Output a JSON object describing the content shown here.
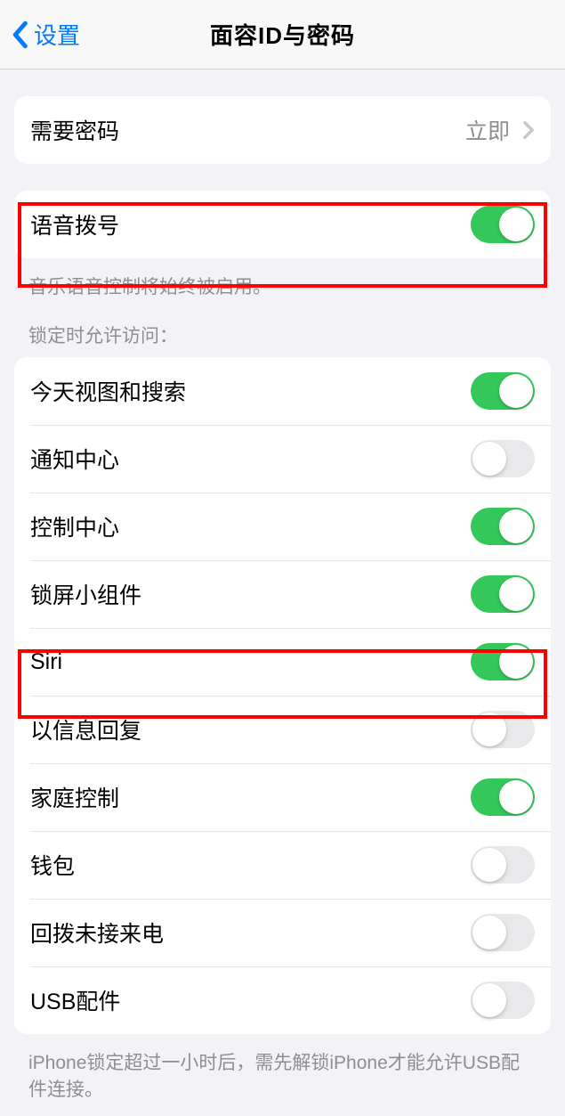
{
  "nav": {
    "back_label": "设置",
    "title": "面容ID与密码"
  },
  "group1": {
    "require_passcode": {
      "label": "需要密码",
      "value": "立即"
    }
  },
  "group2": {
    "voice_dial": {
      "label": "语音拨号",
      "on": true
    },
    "footer": "音乐语音控制将始终被启用。"
  },
  "group3": {
    "header": "锁定时允许访问：",
    "items": [
      {
        "label": "今天视图和搜索",
        "on": true
      },
      {
        "label": "通知中心",
        "on": false
      },
      {
        "label": "控制中心",
        "on": true
      },
      {
        "label": "锁屏小组件",
        "on": true
      },
      {
        "label": "Siri",
        "on": true
      },
      {
        "label": "以信息回复",
        "on": false
      },
      {
        "label": "家庭控制",
        "on": true
      },
      {
        "label": "钱包",
        "on": false
      },
      {
        "label": "回拨未接来电",
        "on": false
      },
      {
        "label": "USB配件",
        "on": false
      }
    ],
    "footer": "iPhone锁定超过一小时后，需先解锁iPhone才能允许USB配件连接。"
  }
}
